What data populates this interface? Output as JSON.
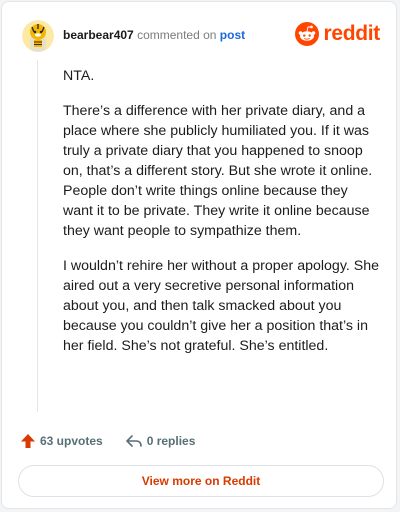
{
  "header": {
    "username": "bearbear407",
    "action_text": "commented on",
    "post_link": "post",
    "brand": "reddit"
  },
  "comment": {
    "paragraphs": [
      "NTA.",
      "There’s a difference with her private diary, and a place where she publicly humiliated you. If it was truly a private diary that you happened to snoop on, that’s a different story. But she wrote it online. People don’t write things online because they want it to be private. They write it online because they want people to sympathize them.",
      "I wouldn’t rehire her without a proper apology. She aired out a very secretive personal information about you, and then talk smacked about you because you couldn’t give her a position that’s in her field. She’s not grateful. She’s entitled."
    ]
  },
  "actions": {
    "upvotes": "63 upvotes",
    "replies": "0 replies"
  },
  "footer": {
    "button_label": "View more on Reddit"
  },
  "icons": {
    "avatar": "snoo-tiger-avatar-icon",
    "brand": "reddit-snoo-icon",
    "upvote": "upvote-arrow-icon",
    "reply": "reply-arrow-icon"
  },
  "colors": {
    "brand": "#ff4500",
    "link": "#1a6ad6",
    "upvote": "#d93a00",
    "muted": "#576f76"
  }
}
